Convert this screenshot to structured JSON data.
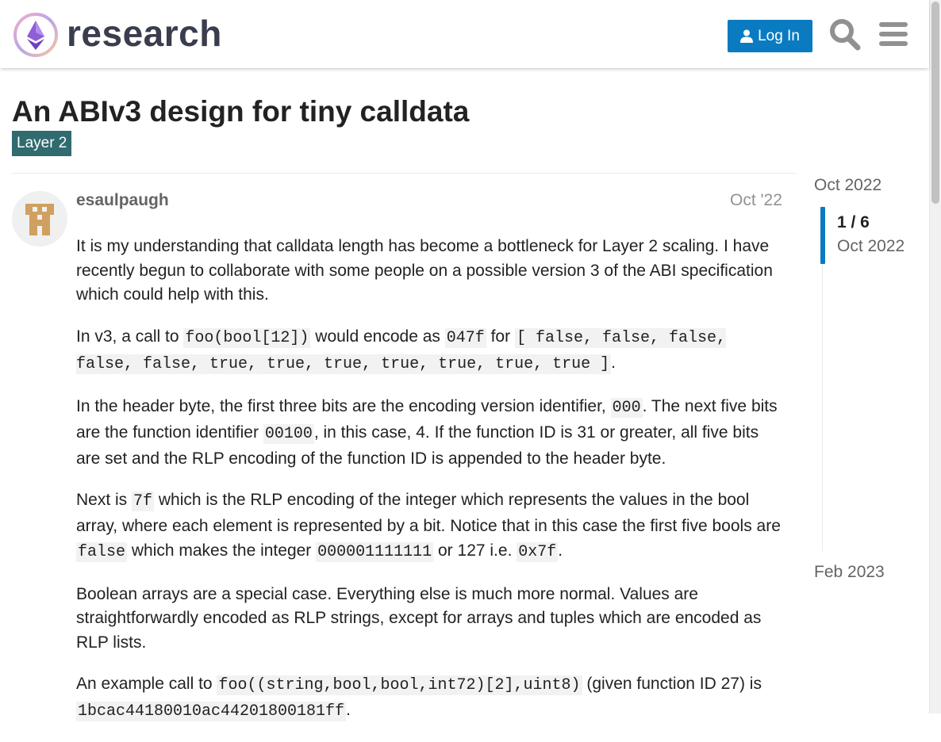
{
  "header": {
    "site_name": "research",
    "login_label": "Log In",
    "brand_color": "#0a7bc1",
    "icons": [
      "search-icon",
      "hamburger-menu-icon",
      "user-icon"
    ]
  },
  "topic": {
    "title": "An ABIv3 design for tiny calldata",
    "category": "Layer 2",
    "category_color": "#2f6b6f"
  },
  "post": {
    "username": "esaulpaugh",
    "date": "Oct '22",
    "p1": "It is my understanding that calldata length has become a bottleneck for Layer 2 scaling. I have recently begun to collaborate with some people on a possible version 3 of the ABI specification which could help with this.",
    "p2": {
      "t1": "In v3, a call to ",
      "c1": "foo(bool[12])",
      "t2": " would encode as ",
      "c2": "047f",
      "t3": " for ",
      "c3": "[ false, false, false, false, false, true, true, true, true, true, true, true ]",
      "t4": "."
    },
    "p3": {
      "t1": "In the header byte, the first three bits are the encoding version identifier, ",
      "c1": "000",
      "t2": ". The next five bits are the function identifier ",
      "c2": "00100",
      "t3": ", in this case, 4. If the function ID is 31 or greater, all five bits are set and the RLP encoding of the function ID is appended to the header byte."
    },
    "p4": {
      "t1": "Next is ",
      "c1": "7f",
      "t2": " which is the RLP encoding of the integer which represents the values in the bool array, where each element is represented by a bit. Notice that in this case the first five bools are ",
      "c2": "false",
      "t3": " which makes the integer ",
      "c3": "000001111111",
      "t4": " or 127 i.e. ",
      "c4": "0x7f",
      "t5": "."
    },
    "p5": "Boolean arrays are a special case. Everything else is much more normal. Values are straightforwardly encoded as RLP strings, except for arrays and tuples which are encoded as RLP lists.",
    "p6": {
      "t1": "An example call to ",
      "c1": "foo((string,bool,bool,int72)[2],uint8)",
      "t2": " (given function ID 27) is ",
      "c2": "1bcac44180010ac44201800181ff",
      "t3": "."
    }
  },
  "timeline": {
    "start_date": "Oct 2022",
    "counter": "1 / 6",
    "counter_date": "Oct 2022",
    "end_date": "Feb 2023"
  }
}
